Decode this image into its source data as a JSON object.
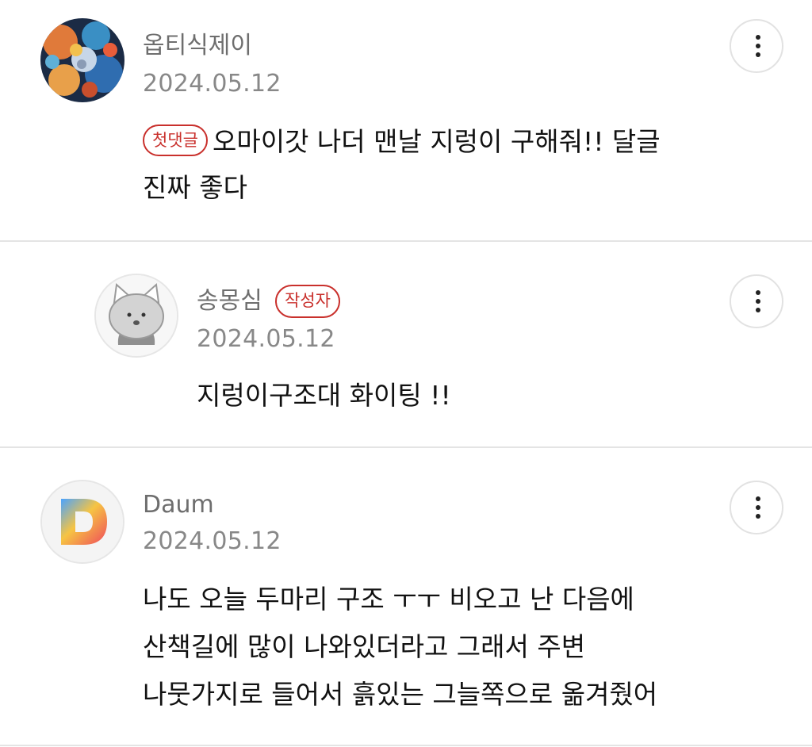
{
  "comments": [
    {
      "author": "옵티식제이",
      "date": "2024.05.12",
      "badge": "첫댓글",
      "lines": [
        "오마이갓 나더 맨날 지렁이 구해줘!! 달글",
        "진짜 좋다"
      ],
      "avatar_icon": "painting-avatar",
      "more_icon": "more-vertical-icon"
    },
    {
      "author": "송몽심",
      "date": "2024.05.12",
      "badge": "작성자",
      "lines": [
        "지렁이구조대 화이팅 !!"
      ],
      "avatar_icon": "cat-avatar",
      "is_reply": true,
      "more_icon": "more-vertical-icon"
    },
    {
      "author": "Daum",
      "date": "2024.05.12",
      "lines": [
        "나도 오늘 두마리 구조 ㅜㅜ 비오고 난 다음에",
        "산책길에 많이 나와있더라고 그래서 주변",
        "나뭇가지로 들어서 흙있는 그늘쪽으로 옮겨줬어"
      ],
      "avatar_icon": "daum-logo-avatar",
      "more_icon": "more-vertical-icon"
    }
  ],
  "colors": {
    "badge": "#c9302c",
    "name": "#6e6e6e",
    "date": "#888888",
    "divider": "#e4e4e4"
  }
}
